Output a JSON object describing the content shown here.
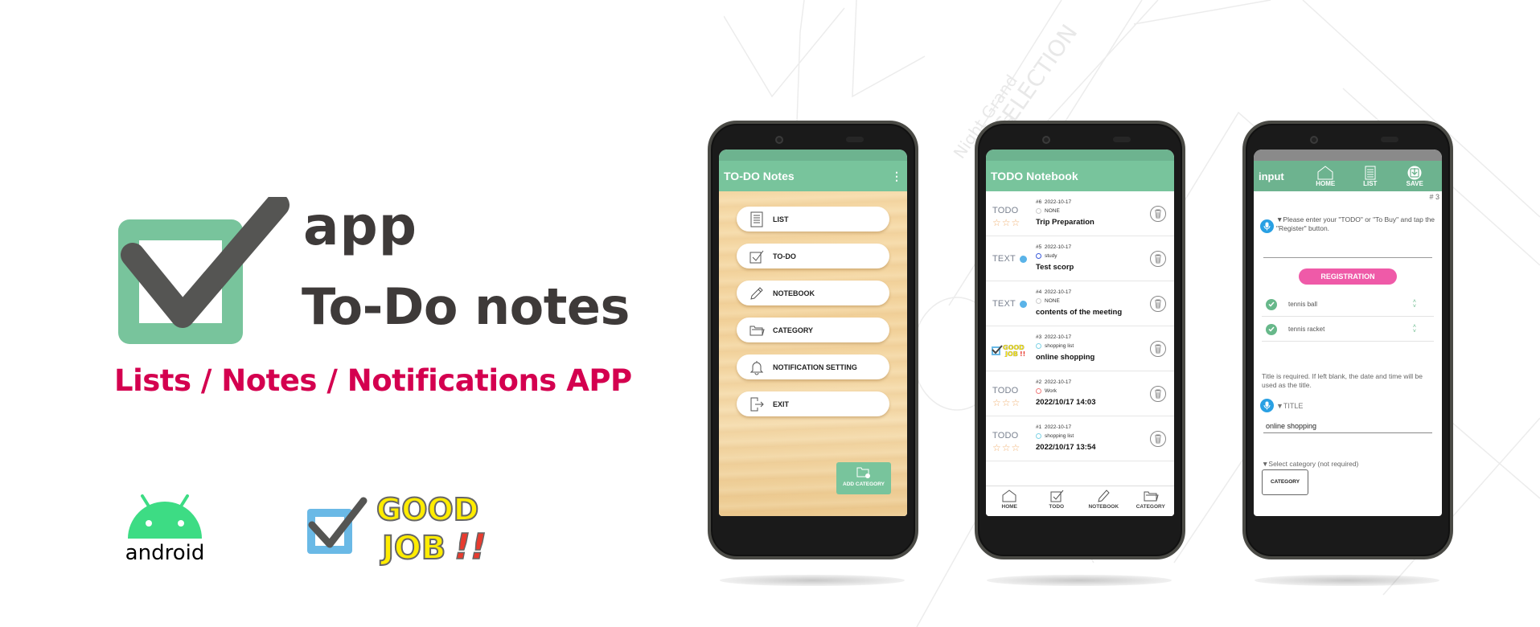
{
  "brand": {
    "app_label": "app",
    "title": "To-Do notes",
    "tagline": "Lists / Notes / Notifications APP",
    "colors": {
      "green": "#78c49c",
      "dark": "#3e3a39",
      "accent": "#d4004f"
    }
  },
  "badges": {
    "android_label": "android",
    "goodjob_line1": "GOOD",
    "goodjob_line2": "JOB!!"
  },
  "phone1": {
    "appbar_title": "TO-DO Notes",
    "menu": [
      {
        "label": "LIST",
        "icon": "list-icon"
      },
      {
        "label": "TO-DO",
        "icon": "checkbox-icon"
      },
      {
        "label": "NOTEBOOK",
        "icon": "pencil-icon"
      },
      {
        "label": "CATEGORY",
        "icon": "folder-icon"
      },
      {
        "label": "NOTIFICATION SETTING",
        "icon": "bell-icon"
      },
      {
        "label": "EXIT",
        "icon": "exit-icon"
      }
    ],
    "add_category_label": "ADD CATEGORY"
  },
  "phone2": {
    "appbar_title": "TODO Notebook",
    "rows": [
      {
        "kind": "TODO",
        "stars": "☆☆☆",
        "id": "#6",
        "date": "2022-10-17",
        "category": "NONE",
        "cat_color": "#cccccc",
        "title": "Trip Preparation"
      },
      {
        "kind": "TEXT",
        "id": "#5",
        "date": "2022-10-17",
        "category": "study",
        "cat_color": "#3b5bdb",
        "title": "Test scorp"
      },
      {
        "kind": "TEXT",
        "id": "#4",
        "date": "2022-10-17",
        "category": "NONE",
        "cat_color": "#cccccc",
        "title": "contents of the meeting"
      },
      {
        "kind": "GOOD JOB",
        "id": "#3",
        "date": "2022-10-17",
        "category": "shopping list",
        "cat_color": "#7fd3e6",
        "title": "online shopping"
      },
      {
        "kind": "TODO",
        "stars": "☆☆☆",
        "id": "#2",
        "date": "2022-10-17",
        "category": "Work",
        "cat_color": "#ef7f7f",
        "title": "2022/10/17 14:03"
      },
      {
        "kind": "TODO",
        "stars": "☆☆☆",
        "id": "#1",
        "date": "2022-10-17",
        "category": "shopping list",
        "cat_color": "#7fd3e6",
        "title": "2022/10/17 13:54"
      }
    ],
    "nav": [
      {
        "label": "HOME",
        "icon": "home-icon"
      },
      {
        "label": "TODO",
        "icon": "checkbox-icon"
      },
      {
        "label": "NOTEBOOK",
        "icon": "pencil-icon"
      },
      {
        "label": "CATEGORY",
        "icon": "folder-icon"
      }
    ]
  },
  "phone3": {
    "appbar_title": "input",
    "toolbar": {
      "home": "HOME",
      "list": "LIST",
      "save": "SAVE"
    },
    "number": "# 3",
    "hint": "▼Please enter your \"TODO\" or \"To Buy\" and tap the \"Register\" button.",
    "registration_label": "REGISTRATION",
    "items": [
      "tennis ball",
      "tennis racket"
    ],
    "note": "Title is required. If left blank, the date and time will be used as the title.",
    "title_label": "▼TITLE",
    "title_value": "online shopping",
    "category_label": "▼Select category (not required)",
    "category_button": "CATEGORY"
  }
}
